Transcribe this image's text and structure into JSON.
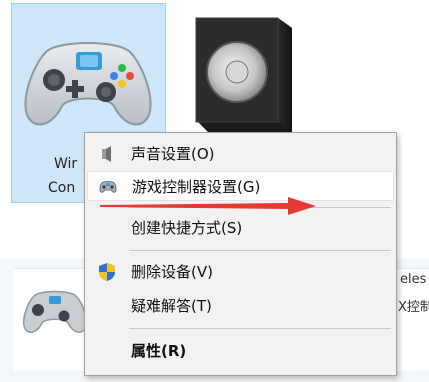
{
  "devices": {
    "selected_label_line1": "Wir",
    "selected_label_line2": "Con",
    "side_text_line1": "eles",
    "side_text_line2": "X控制",
    "selected_icon": "gamepad-icon",
    "speaker_icon": "speaker-icon"
  },
  "context_menu": {
    "items": [
      {
        "label": "声音设置(O)",
        "icon": "speaker-small-icon"
      },
      {
        "label": "游戏控制器设置(G)",
        "icon": "gamepad-small-icon"
      },
      {
        "label": "创建快捷方式(S)",
        "icon": ""
      },
      {
        "label": "删除设备(V)",
        "icon": "shield-icon"
      },
      {
        "label": "疑难解答(T)",
        "icon": ""
      },
      {
        "label": "属性(R)",
        "icon": ""
      }
    ]
  },
  "colors": {
    "selection_bg": "#cfe6f8",
    "selection_border": "#99d1ff",
    "menu_bg": "#f2f2f2",
    "annotation_arrow": "#e53935"
  }
}
